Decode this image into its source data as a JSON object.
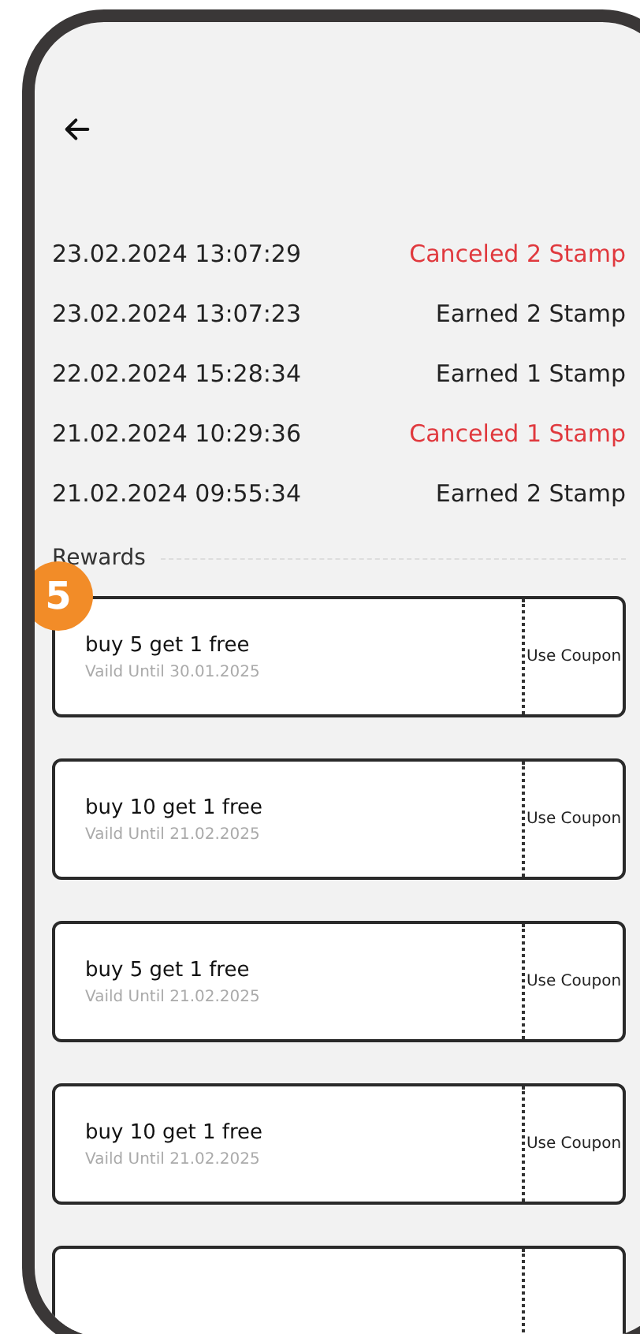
{
  "history": [
    {
      "time": "23.02.2024 13:07:29",
      "action": "Canceled 2 Stamp",
      "kind": "canceled"
    },
    {
      "time": "23.02.2024 13:07:23",
      "action": "Earned 2 Stamp",
      "kind": "earned"
    },
    {
      "time": "22.02.2024 15:28:34",
      "action": "Earned 1 Stamp",
      "kind": "earned"
    },
    {
      "time": "21.02.2024 10:29:36",
      "action": "Canceled 1 Stamp",
      "kind": "canceled"
    },
    {
      "time": "21.02.2024 09:55:34",
      "action": "Earned 2 Stamp",
      "kind": "earned"
    }
  ],
  "rewards_title": "Rewards",
  "step_badge": "5",
  "coupons": [
    {
      "title": "buy 5 get 1 free",
      "validity": "Vaild Until 30.01.2025",
      "action": "Use Coupon"
    },
    {
      "title": "buy 10 get 1 free",
      "validity": "Vaild Until 21.02.2025",
      "action": "Use Coupon"
    },
    {
      "title": "buy 5 get 1 free",
      "validity": "Vaild Until 21.02.2025",
      "action": "Use Coupon"
    },
    {
      "title": "buy 10 get 1 free",
      "validity": "Vaild Until 21.02.2025",
      "action": "Use Coupon"
    }
  ]
}
